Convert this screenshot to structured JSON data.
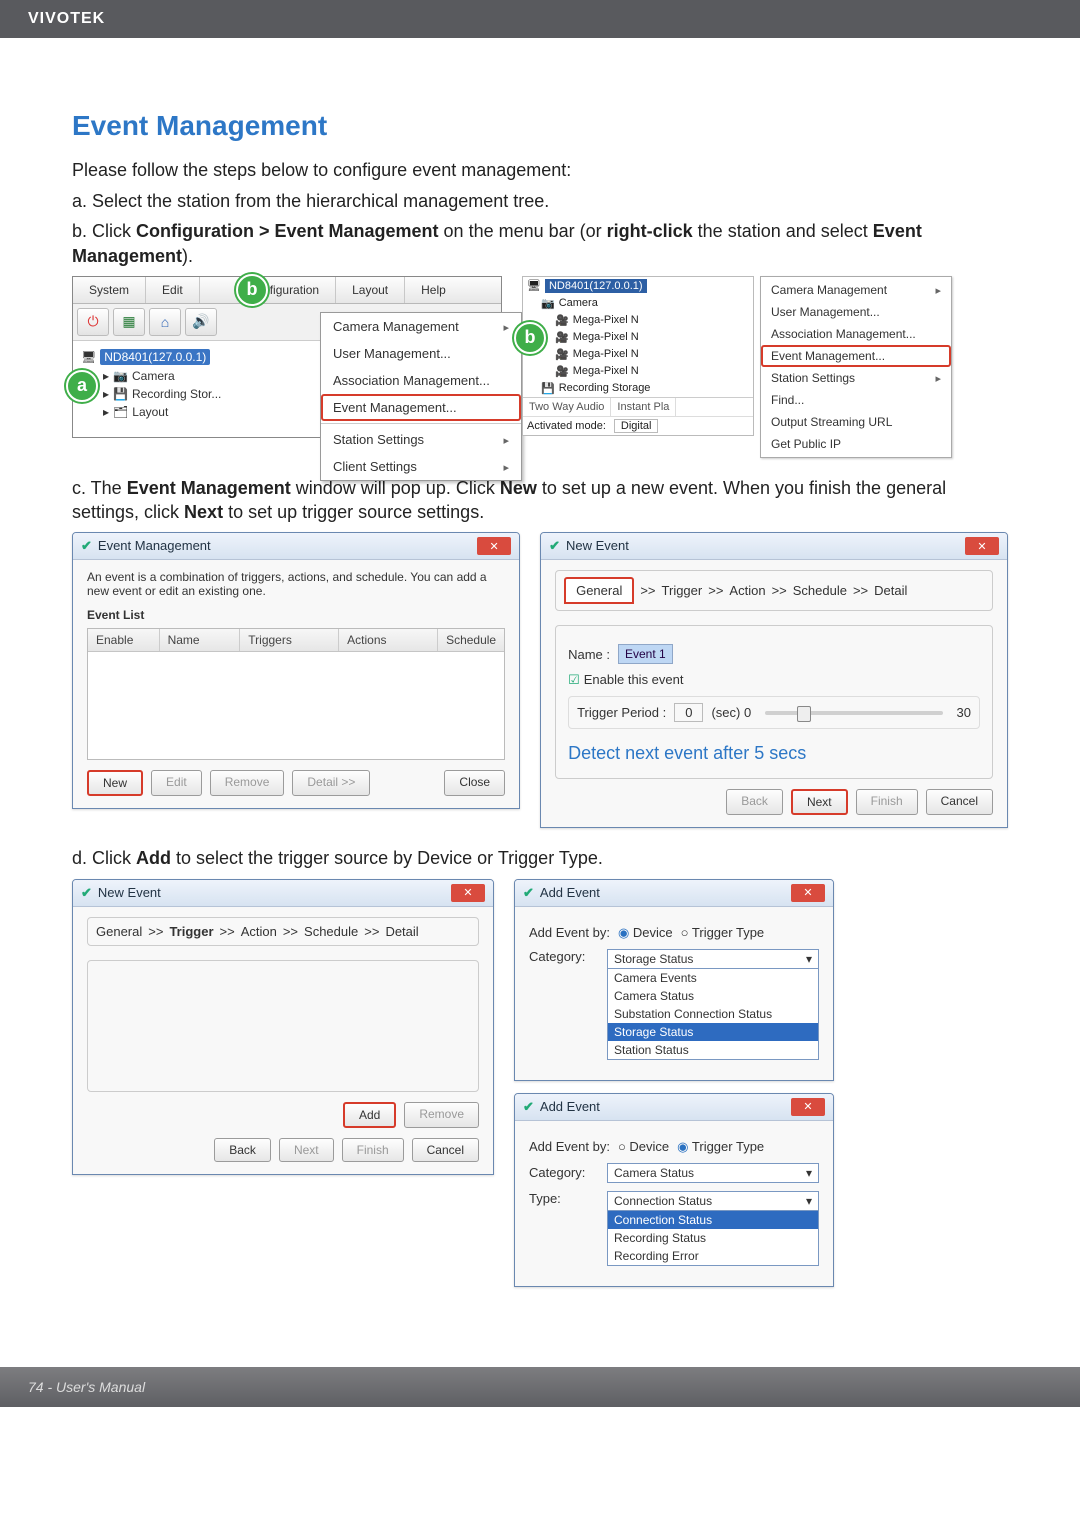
{
  "header": {
    "brand": "VIVOTEK"
  },
  "section_title": "Event Management",
  "intro": "Please follow the steps below to configure event management:",
  "steps": {
    "a": "a. Select the station from the hierarchical management tree.",
    "b_pre": "b. Click ",
    "b_bold1": "Configuration > Event Management",
    "b_mid": " on the menu bar (or ",
    "b_bold2": "right-click",
    "b_mid2": " the station and select ",
    "b_bold3": "Event Management",
    "b_post": ").",
    "c_pre": "c. The ",
    "c_b1": "Event Management",
    "c_mid1": " window will pop up. Click ",
    "c_b2": "New",
    "c_mid2": " to set up a new event. When you finish the general settings, click ",
    "c_b3": "Next",
    "c_post": " to set up trigger source settings.",
    "d_pre": "d. Click ",
    "d_b1": "Add",
    "d_post": " to select the trigger source by Device or Trigger Type."
  },
  "fig_b_left": {
    "menubar": {
      "system": "System",
      "edit": "Edit",
      "config": "Configuration",
      "layout": "Layout",
      "help": "Help"
    },
    "submenu": {
      "cam_mgmt": "Camera Management",
      "user_mgmt": "User Management...",
      "assoc_mgmt": "Association Management...",
      "event_mgmt": "Event Management...",
      "station_settings": "Station Settings",
      "client_settings": "Client Settings"
    },
    "tree": {
      "root": "ND8401(127.0.0.1)",
      "n1": "Camera",
      "n2": "Recording Stor...",
      "n3": "Layout"
    },
    "badge_a": "a",
    "badge_b": "b"
  },
  "fig_b_right": {
    "tree": {
      "root": "ND8401(127.0.0.1)",
      "cam": "Camera",
      "mp1": "Mega-Pixel N",
      "mp2": "Mega-Pixel N",
      "mp3": "Mega-Pixel N",
      "mp4": "Mega-Pixel N",
      "rs": "Recording Storage"
    },
    "tabs": {
      "t1": "Two Way Audio",
      "t2": "Instant Pla"
    },
    "mode_label": "Activated mode:",
    "mode_val": "Digital",
    "context": {
      "c1": "Camera Management",
      "c2": "User Management...",
      "c3": "Association Management...",
      "c4": "Event Management...",
      "c5": "Station Settings",
      "c6": "Find...",
      "c7": "Output Streaming URL",
      "c8": "Get Public IP"
    },
    "badge_b": "b"
  },
  "fig_c_left": {
    "title": "Event Management",
    "desc": "An event is a combination of triggers, actions, and schedule. You can add a new event or edit an existing one.",
    "list_label": "Event List",
    "cols": {
      "enable": "Enable",
      "name": "Name",
      "triggers": "Triggers",
      "actions": "Actions",
      "schedule": "Schedule"
    },
    "btns": {
      "new": "New",
      "edit": "Edit",
      "remove": "Remove",
      "detail": "Detail >>",
      "close": "Close"
    }
  },
  "fig_c_right": {
    "title": "New Event",
    "crumbs": {
      "general": "General",
      "trigger": "Trigger",
      "action": "Action",
      "schedule": "Schedule",
      "detail": "Detail",
      "sep": ">>"
    },
    "name_lbl": "Name  :",
    "name_val": "Event 1",
    "enable": "Enable this event",
    "tp_lbl": "Trigger Period  :",
    "tp_val": "0",
    "tp_unit": "(sec)  0",
    "tp_max": "30",
    "note": "Detect next event after 5 secs",
    "btns": {
      "back": "Back",
      "next": "Next",
      "finish": "Finish",
      "cancel": "Cancel"
    }
  },
  "fig_d_left": {
    "title": "New Event",
    "crumbs": {
      "general": "General",
      "trigger": "Trigger",
      "action": "Action",
      "schedule": "Schedule",
      "detail": "Detail",
      "sep": ">>"
    },
    "btns": {
      "add": "Add",
      "remove": "Remove",
      "back": "Back",
      "next": "Next",
      "finish": "Finish",
      "cancel": "Cancel"
    }
  },
  "fig_d_right_top": {
    "title": "Add Event",
    "by_lbl": "Add Event by:",
    "opt_device": "Device",
    "opt_type": "Trigger Type",
    "cat_lbl": "Category:",
    "cat_val": "Storage Status",
    "opts": [
      "Camera Events",
      "Camera Status",
      "Substation Connection Status",
      "Storage Status",
      "Station Status"
    ]
  },
  "fig_d_right_bot": {
    "title": "Add Event",
    "by_lbl": "Add Event by:",
    "opt_device": "Device",
    "opt_type": "Trigger Type",
    "cat_lbl": "Category:",
    "cat_val": "Camera Status",
    "type_lbl": "Type:",
    "type_val": "Connection Status",
    "opts": [
      "Connection Status",
      "Recording Status",
      "Recording Error"
    ]
  },
  "footer": {
    "page": "74 - User's Manual"
  }
}
